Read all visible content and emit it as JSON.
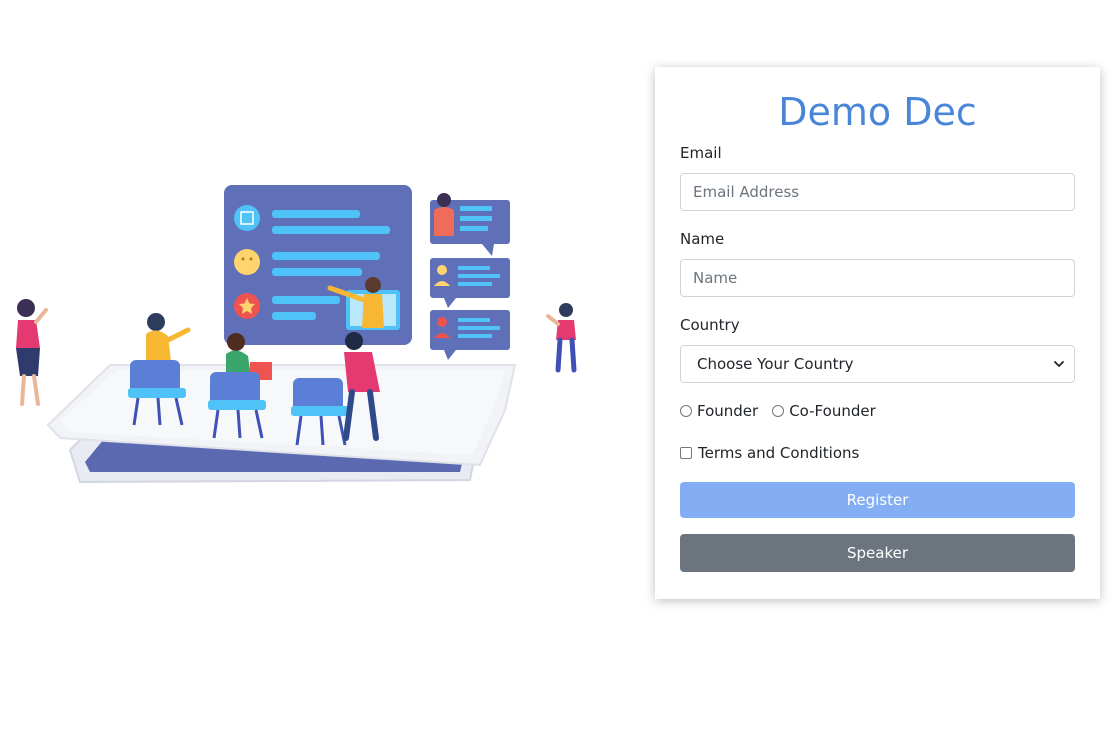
{
  "form": {
    "title": "Demo Dec",
    "email": {
      "label": "Email",
      "placeholder": "Email Address",
      "value": ""
    },
    "name": {
      "label": "Name",
      "placeholder": "Name",
      "value": ""
    },
    "country": {
      "label": "Country",
      "selected": "Choose Your Country"
    },
    "role_options": [
      "Founder",
      "Co-Founder"
    ],
    "terms_label": "Terms and Conditions",
    "register_label": "Register",
    "speaker_label": "Speaker"
  },
  "colors": {
    "title": "#4a86d8",
    "register_button": "#83aef4",
    "speaker_button": "#6c757d",
    "illustration_board": "#5f6fb8",
    "illustration_accent": "#4fc3f7"
  },
  "illustration": {
    "description_icons": [
      "edit-icon",
      "smiley-icon",
      "star-icon",
      "user-icon"
    ]
  }
}
